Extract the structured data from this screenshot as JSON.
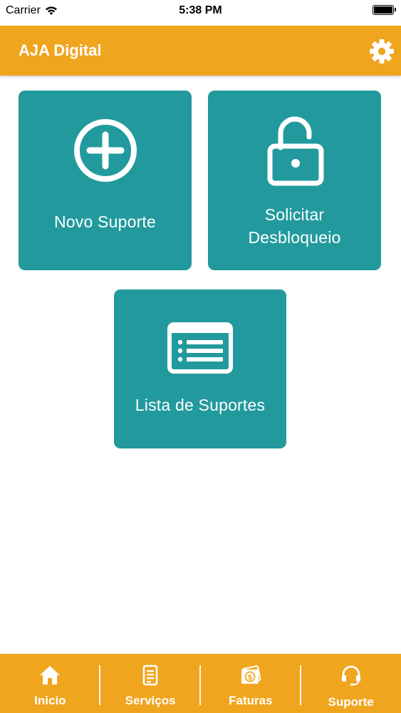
{
  "status_bar": {
    "carrier": "Carrier",
    "time": "5:38 PM"
  },
  "header": {
    "title": "AJA Digital"
  },
  "tiles": [
    {
      "label": "Novo Suporte",
      "icon": "plus-circle-icon"
    },
    {
      "label_line1": "Solicitar",
      "label_line2": "Desbloqueio",
      "icon": "unlock-icon"
    },
    {
      "label": "Lista de Suportes",
      "icon": "list-icon"
    }
  ],
  "tabs": [
    {
      "label": "Inicio",
      "icon": "home-icon"
    },
    {
      "label": "Serviços",
      "icon": "document-icon"
    },
    {
      "label": "Faturas",
      "icon": "money-icon"
    },
    {
      "label": "Suporte",
      "icon": "headset-icon",
      "active": true
    }
  ],
  "colors": {
    "primary": "#f0a51f",
    "tile": "#229a9d",
    "text_on_color": "#ffffff"
  }
}
